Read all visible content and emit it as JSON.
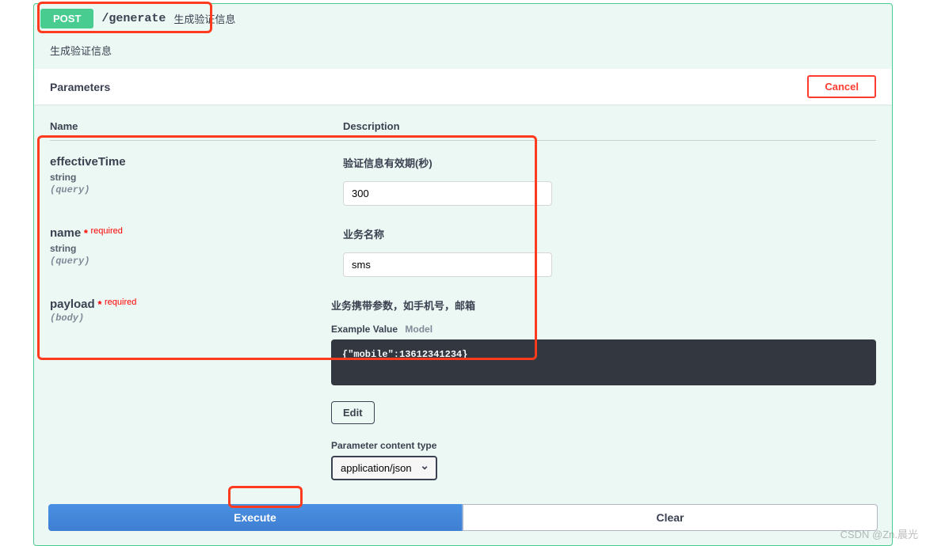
{
  "op": {
    "method": "POST",
    "path": "/generate",
    "summary": "生成验证信息",
    "description": "生成验证信息"
  },
  "parametersHeading": "Parameters",
  "cancelLabel": "Cancel",
  "columns": {
    "name": "Name",
    "description": "Description"
  },
  "requiredLabel": "required",
  "params": [
    {
      "name": "effectiveTime",
      "type": "string",
      "in": "(query)",
      "required": false,
      "description": "验证信息有效期(秒)",
      "value": "300"
    },
    {
      "name": "name",
      "type": "string",
      "in": "(query)",
      "required": true,
      "description": "业务名称",
      "value": "sms"
    },
    {
      "name": "payload",
      "type": "",
      "in": "(body)",
      "required": true,
      "description": "业务携带参数，如手机号，邮箱",
      "body": "{\"mobile\":13612341234}"
    }
  ],
  "bodyTabs": {
    "active": "Example Value",
    "inactive": "Model"
  },
  "editLabel": "Edit",
  "contentTypeLabel": "Parameter content type",
  "contentType": "application/json",
  "executeLabel": "Execute",
  "clearLabel": "Clear",
  "watermark": "CSDN @Zn.晨光"
}
